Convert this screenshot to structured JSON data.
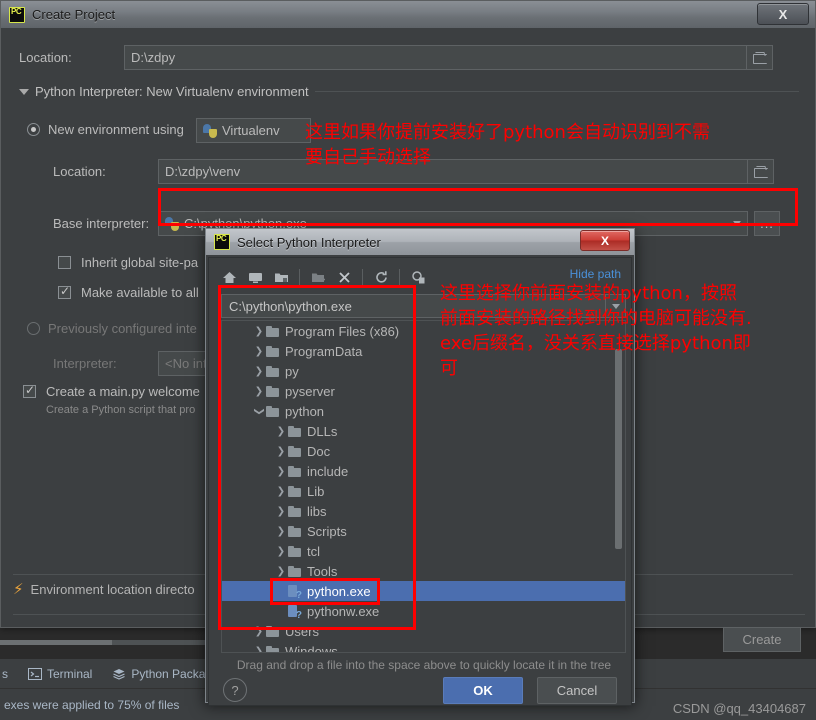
{
  "ide": {
    "bottom_tabs": [
      {
        "label": "Terminal",
        "icon": "terminal-icon"
      },
      {
        "label": "Python Packa",
        "icon": "packages-icon"
      }
    ],
    "status_text": "exes were applied to 75% of files",
    "watermark": "CSDN @qq_43404687"
  },
  "create_project": {
    "title": "Create Project",
    "window_icon": "pycharm-logo-icon",
    "close_label": "X",
    "location_label": "Location:",
    "location_value": "D:\\zdpy",
    "browse_icon": "folder-icon",
    "section_title": "Python Interpreter: New Virtualenv environment",
    "new_env_label": "New environment using",
    "new_env_tool": "Virtualenv",
    "venv_location_label": "Location:",
    "venv_location_value": "D:\\zdpy\\venv",
    "base_interpreter_label": "Base interpreter:",
    "base_interpreter_value": "C:\\python\\python.exe",
    "dots_label": "...",
    "inherit_label": "Inherit global site-pa",
    "make_available_label": "Make available to all",
    "previously_configured_label": "Previously configured inte",
    "interpreter_label": "Interpreter:",
    "interpreter_value": "<No interp",
    "main_py_label": "Create a main.py welcome",
    "main_py_sub": "Create a Python script that pro",
    "warning_text": "Environment location directo",
    "warning_icon": "warning-bolt-icon",
    "create_label": "Create"
  },
  "select_interpreter": {
    "title": "Select Python Interpreter",
    "window_icon": "pycharm-logo-icon",
    "close_label": "X",
    "toolbar": [
      {
        "name": "home-icon"
      },
      {
        "name": "desktop-icon"
      },
      {
        "name": "project-folder-icon"
      },
      {
        "name": "new-folder-icon"
      },
      {
        "name": "delete-icon"
      },
      {
        "name": "refresh-icon"
      },
      {
        "name": "show-hidden-icon"
      }
    ],
    "hide_path_label": "Hide path",
    "path_value": "C:\\python\\python.exe",
    "tree": [
      {
        "label": "Program Files (x86)",
        "indent": 1,
        "chev": "right",
        "type": "folder",
        "selected": false
      },
      {
        "label": "ProgramData",
        "indent": 1,
        "chev": "right",
        "type": "folder",
        "selected": false
      },
      {
        "label": "py",
        "indent": 1,
        "chev": "right",
        "type": "folder",
        "selected": false
      },
      {
        "label": "pyserver",
        "indent": 1,
        "chev": "right",
        "type": "folder",
        "selected": false
      },
      {
        "label": "python",
        "indent": 1,
        "chev": "down",
        "type": "folder",
        "selected": false
      },
      {
        "label": "DLLs",
        "indent": 2,
        "chev": "right",
        "type": "folder",
        "selected": false
      },
      {
        "label": "Doc",
        "indent": 2,
        "chev": "right",
        "type": "folder",
        "selected": false
      },
      {
        "label": "include",
        "indent": 2,
        "chev": "right",
        "type": "folder",
        "selected": false
      },
      {
        "label": "Lib",
        "indent": 2,
        "chev": "right",
        "type": "folder",
        "selected": false
      },
      {
        "label": "libs",
        "indent": 2,
        "chev": "right",
        "type": "folder",
        "selected": false
      },
      {
        "label": "Scripts",
        "indent": 2,
        "chev": "right",
        "type": "folder",
        "selected": false
      },
      {
        "label": "tcl",
        "indent": 2,
        "chev": "right",
        "type": "folder",
        "selected": false
      },
      {
        "label": "Tools",
        "indent": 2,
        "chev": "right",
        "type": "folder",
        "selected": false
      },
      {
        "label": "python.exe",
        "indent": 2,
        "chev": "none",
        "type": "exe",
        "selected": true
      },
      {
        "label": "pythonw.exe",
        "indent": 2,
        "chev": "none",
        "type": "exe",
        "selected": false
      },
      {
        "label": "Users",
        "indent": 1,
        "chev": "right",
        "type": "folder",
        "selected": false
      },
      {
        "label": "Windows",
        "indent": 1,
        "chev": "right",
        "type": "folder",
        "selected": false
      }
    ],
    "hint": "Drag and drop a file into the space above to quickly locate it in the tree",
    "help_label": "?",
    "ok_label": "OK",
    "cancel_label": "Cancel"
  },
  "annotations": {
    "color": "#fe0000",
    "note_top": "这里如果你提前安装好了python会自动识别到不需\n要自己手动选择",
    "note_right": "这里选择你前面安装的python，按照\n前面安装的路径找到你的电脑可能没有.\nexe后缀名，没关系直接选择python即\n可"
  }
}
